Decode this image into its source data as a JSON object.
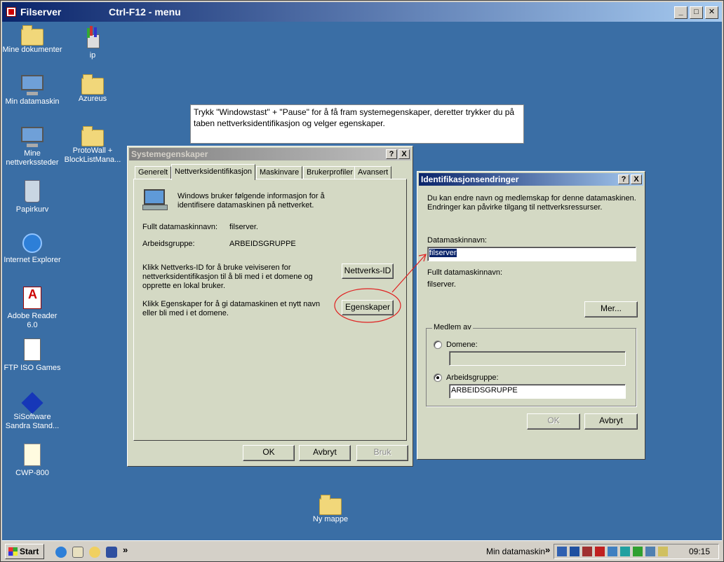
{
  "outer": {
    "title": "Filserver",
    "menu_hint": "Ctrl-F12 - menu",
    "minimize": "_",
    "maximize": "□",
    "close": "✕"
  },
  "desktop_icons": [
    {
      "label": "Mine dokumenter",
      "icon": "folder-docs-icon"
    },
    {
      "label": "ip",
      "icon": "paint-brush-icon"
    },
    {
      "label": "Min datamaskin",
      "icon": "computer-icon"
    },
    {
      "label": "Azureus",
      "icon": "folder-icon"
    },
    {
      "label": "Mine nettverkssteder",
      "icon": "network-icon"
    },
    {
      "label": "ProtoWall + BlockListMana...",
      "icon": "folder-icon"
    },
    {
      "label": "Papirkurv",
      "icon": "recycle-bin-icon"
    },
    {
      "label": "Internet Explorer",
      "icon": "ie-icon"
    },
    {
      "label": "Adobe Reader 6.0",
      "icon": "adobe-reader-icon"
    },
    {
      "label": "FTP ISO Games",
      "icon": "document-icon"
    },
    {
      "label": "SiSoftware Sandra Stand...",
      "icon": "sisoftware-icon"
    },
    {
      "label": "CWP-800",
      "icon": "paper-icon"
    },
    {
      "label": "Ny mappe",
      "icon": "folder-icon"
    }
  ],
  "note": {
    "text": "Trykk \"Windowstast\" + \"Pause\" for å få fram systemegenskaper, deretter trykker du på taben nettverksidentifikasjon og velger egenskaper."
  },
  "sysprops": {
    "title": "Systemegenskaper",
    "help": "?",
    "close": "X",
    "tabs": [
      "Generelt",
      "Nettverksidentifikasjon",
      "Maskinvare",
      "Brukerprofiler",
      "Avansert"
    ],
    "intro": "Windows bruker følgende informasjon for å identifisere datamaskinen på nettverket.",
    "full_name_label": "Fullt datamaskinnavn:",
    "full_name_value": "filserver.",
    "workgroup_label": "Arbeidsgruppe:",
    "workgroup_value": "ARBEIDSGRUPPE",
    "netid_text": "Klikk Nettverks-ID for å bruke veiviseren for nettverksidentifikasjon til å bli med i et domene og opprette en lokal bruker.",
    "netid_button": "Nettverks-ID",
    "props_text": "Klikk Egenskaper for å gi datamaskinen et nytt navn eller bli med i et domene.",
    "props_button": "Egenskaper",
    "ok": "OK",
    "cancel": "Avbryt",
    "apply": "Bruk"
  },
  "idchanges": {
    "title": "Identifikasjonsendringer",
    "help": "?",
    "close": "X",
    "intro": "Du kan endre navn og medlemskap for denne datamaskinen. Endringer kan påvirke tilgang til nettverksressurser.",
    "name_label": "Datamaskinnavn:",
    "name_value": "filserver",
    "full_name_label": "Fullt datamaskinnavn:",
    "full_name_value": "filserver.",
    "more_button": "Mer...",
    "member_of": "Medlem av",
    "domain_label": "Domene:",
    "domain_value": "",
    "workgroup_label": "Arbeidsgruppe:",
    "workgroup_value": "ARBEIDSGRUPPE",
    "ok": "OK",
    "cancel": "Avbryt"
  },
  "taskbar": {
    "start": "Start",
    "chevron": "»",
    "task_item": "Min datamaskin",
    "clock": "09:15"
  },
  "colors": {
    "desktop": "#3a6ea5",
    "dialog": "#d4d9c4",
    "annotation_red": "#e02020"
  }
}
